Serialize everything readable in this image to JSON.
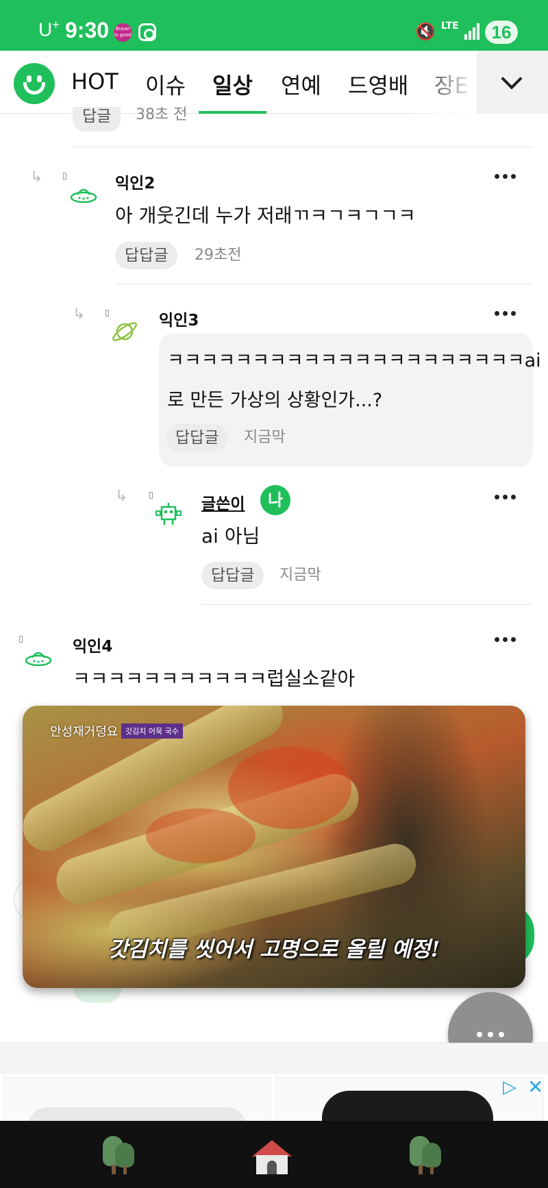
{
  "status_bar": {
    "carrier": "U",
    "carrier_sup": "+",
    "time": "9:30",
    "app_badge": "Busan is good",
    "network": "LTE",
    "battery": "16"
  },
  "tabs": {
    "items": [
      "HOT",
      "이슈",
      "일상",
      "연예",
      "드영배",
      "장E"
    ],
    "active": "일상"
  },
  "comments": [
    {
      "chip": "답글",
      "time": "38초 전"
    },
    {
      "nick": "익인2",
      "text": "아 개웃긴데 누가 저래ㄲㅋㄱㅋㄱㄱㅋ",
      "chip": "답답글",
      "time": "29초전"
    },
    {
      "nick": "익인3",
      "text_line1": "ㅋㅋㅋㅋㅋㅋㅋㅋㅋㅋㅋㅋㅋㅋㅋㅋㅋㅋㅋㅋㅋai",
      "text_line2": "로 만든 가상의 상황인가...?",
      "chip": "답답글",
      "time": "지금막"
    },
    {
      "nick": "글쓴이",
      "badge": "나",
      "text": "ai 아님",
      "chip": "답답글",
      "time": "지금막"
    },
    {
      "nick": "익인4",
      "text": "ㅋㅋㅋㅋㅋㅋㅋㅋㅋㅋㅋ럽실소같아"
    }
  ],
  "video": {
    "channel_logo": "안성재거덩요",
    "tag": "갓김치 어묵 국수",
    "caption": "갓김치를 씻어서 고명으로 올릴 예정!"
  },
  "icons": {
    "reply": "reply-arrow-icon",
    "more": "more-dots-icon",
    "fab": "more-dots-icon",
    "expand": "chevron-down-icon",
    "ad_choices": "ad-choices-icon",
    "ad_close": "close-icon"
  },
  "colors": {
    "brand": "#1fbf5b",
    "bubble": "#f3f3f3",
    "chip": "#ececec"
  }
}
